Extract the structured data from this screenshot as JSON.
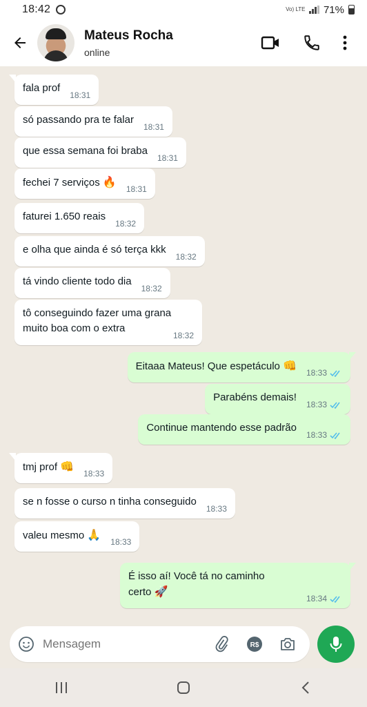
{
  "status_bar": {
    "time": "18:42",
    "network": "Vo) LTE",
    "battery": "71%"
  },
  "header": {
    "name": "Mateus Rocha",
    "status": "online"
  },
  "messages": [
    {
      "dir": "in",
      "text": "fala prof",
      "time": "18:31"
    },
    {
      "dir": "in",
      "text": "só passando pra te falar",
      "time": "18:31"
    },
    {
      "dir": "in",
      "text": "que essa semana foi braba",
      "time": "18:31"
    },
    {
      "dir": "in",
      "text": "fechei 7 serviços",
      "emoji": "🔥",
      "time": "18:31"
    },
    {
      "dir": "in",
      "text": "faturei 1.650 reais",
      "time": "18:32"
    },
    {
      "dir": "in",
      "text": "e olha que ainda é só terça kkk",
      "time": "18:32"
    },
    {
      "dir": "in",
      "text": "tá vindo cliente todo dia",
      "time": "18:32"
    },
    {
      "dir": "in",
      "text": "tô conseguindo fazer uma grana\nmuito boa com o extra",
      "time": "18:32"
    },
    {
      "dir": "out",
      "text": "Eitaaa Mateus! Que espetáculo",
      "emoji": "👊",
      "time": "18:33"
    },
    {
      "dir": "out",
      "text": "Parabéns demais!",
      "time": "18:33"
    },
    {
      "dir": "out",
      "text": "Continue mantendo esse padrão",
      "time": "18:33"
    },
    {
      "dir": "in",
      "text": "tmj prof",
      "emoji": "👊",
      "time": "18:33"
    },
    {
      "dir": "in",
      "text": "se n fosse o curso n tinha conseguido",
      "time": "18:33"
    },
    {
      "dir": "in",
      "text": "valeu mesmo",
      "emoji": "🙏",
      "time": "18:33"
    },
    {
      "dir": "out",
      "text": "É isso aí! Você tá no caminho\ncerto",
      "emoji": "🚀",
      "time": "18:34"
    }
  ],
  "composer": {
    "placeholder": "Mensagem",
    "currency_label": "R$"
  },
  "colors": {
    "accent": "#1fa855",
    "outgoing_bubble": "#d9fdd3",
    "read_ticks": "#53bdeb",
    "wallpaper": "#efeae2"
  }
}
